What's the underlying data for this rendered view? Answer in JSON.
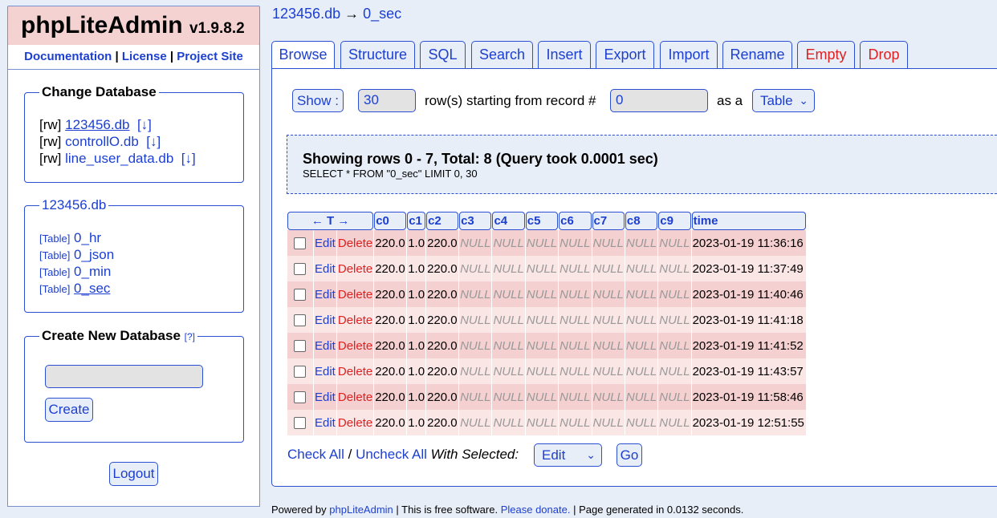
{
  "app": {
    "name": "phpLiteAdmin",
    "version": "v1.9.8.2"
  },
  "top_links": {
    "documentation": "Documentation",
    "sep1": "|",
    "license": "License",
    "sep2": "|",
    "project_site": "Project Site"
  },
  "change_database": {
    "legend": "Change Database",
    "databases": [
      {
        "mode": "[rw]",
        "name": "123456.db",
        "download": "[↓]"
      },
      {
        "mode": "[rw]",
        "name": "controllO.db",
        "download": "[↓]"
      },
      {
        "mode": "[rw]",
        "name": "line_user_data.db",
        "download": "[↓]"
      }
    ]
  },
  "current_db": {
    "legend": "123456.db",
    "tables": [
      {
        "tag": "[Table]",
        "name": "0_hr"
      },
      {
        "tag": "[Table]",
        "name": "0_json"
      },
      {
        "tag": "[Table]",
        "name": "0_min"
      },
      {
        "tag": "[Table]",
        "name": "0_sec"
      }
    ]
  },
  "create_db": {
    "legend": "Create New Database",
    "help": "[?]",
    "input_value": "",
    "button": "Create"
  },
  "logout": "Logout",
  "breadcrumb": {
    "db": "123456.db",
    "arrow": "→",
    "table": "0_sec"
  },
  "tabs": [
    {
      "label": "Browse",
      "active": true
    },
    {
      "label": "Structure"
    },
    {
      "label": "SQL"
    },
    {
      "label": "Search"
    },
    {
      "label": "Insert"
    },
    {
      "label": "Export"
    },
    {
      "label": "Import"
    },
    {
      "label": "Rename"
    },
    {
      "label": "Empty",
      "danger": true
    },
    {
      "label": "Drop",
      "danger": true
    }
  ],
  "browse_controls": {
    "show_button": "Show :",
    "rows_value": "30",
    "rows_text": "row(s) starting from record #",
    "start_value": "0",
    "as_a": "as a",
    "view_select": "Table"
  },
  "query": {
    "heading": "Showing rows 0 - 7, Total: 8 (Query took 0.0001 sec)",
    "sql": "SELECT * FROM \"0_sec\" LIMIT 0, 30"
  },
  "table": {
    "sort_header": "← T →",
    "columns": [
      "c0",
      "c1",
      "c2",
      "c3",
      "c4",
      "c5",
      "c6",
      "c7",
      "c8",
      "c9",
      "time"
    ],
    "edit_label": "Edit",
    "delete_label": "Delete",
    "rows": [
      [
        "220.0",
        "1.0",
        "220.0",
        "NULL",
        "NULL",
        "NULL",
        "NULL",
        "NULL",
        "NULL",
        "NULL",
        "2023-01-19 11:36:16"
      ],
      [
        "220.0",
        "1.0",
        "220.0",
        "NULL",
        "NULL",
        "NULL",
        "NULL",
        "NULL",
        "NULL",
        "NULL",
        "2023-01-19 11:37:49"
      ],
      [
        "220.0",
        "1.0",
        "220.0",
        "NULL",
        "NULL",
        "NULL",
        "NULL",
        "NULL",
        "NULL",
        "NULL",
        "2023-01-19 11:40:46"
      ],
      [
        "220.0",
        "1.0",
        "220.0",
        "NULL",
        "NULL",
        "NULL",
        "NULL",
        "NULL",
        "NULL",
        "NULL",
        "2023-01-19 11:41:18"
      ],
      [
        "220.0",
        "1.0",
        "220.0",
        "NULL",
        "NULL",
        "NULL",
        "NULL",
        "NULL",
        "NULL",
        "NULL",
        "2023-01-19 11:41:52"
      ],
      [
        "220.0",
        "1.0",
        "220.0",
        "NULL",
        "NULL",
        "NULL",
        "NULL",
        "NULL",
        "NULL",
        "NULL",
        "2023-01-19 11:43:57"
      ],
      [
        "220.0",
        "1.0",
        "220.0",
        "NULL",
        "NULL",
        "NULL",
        "NULL",
        "NULL",
        "NULL",
        "NULL",
        "2023-01-19 11:58:46"
      ],
      [
        "220.0",
        "1.0",
        "220.0",
        "NULL",
        "NULL",
        "NULL",
        "NULL",
        "NULL",
        "NULL",
        "NULL",
        "2023-01-19 12:51:55"
      ]
    ]
  },
  "bulk_actions": {
    "check_all": "Check All",
    "sep": "/",
    "uncheck_all": "Uncheck All",
    "with_selected": "With Selected:",
    "action_select": "Edit",
    "go_button": "Go"
  },
  "footer": {
    "powered_by": "Powered by",
    "app_link": "phpLiteAdmin",
    "free_text": "| This is free software.",
    "donate": "Please donate.",
    "generated": "| Page generated in 0.0132 seconds."
  },
  "colors": {
    "accent": "#1c3fd0",
    "danger": "#e02020",
    "header_bg": "#f5d2d2",
    "page_bg": "#e8eef8"
  }
}
